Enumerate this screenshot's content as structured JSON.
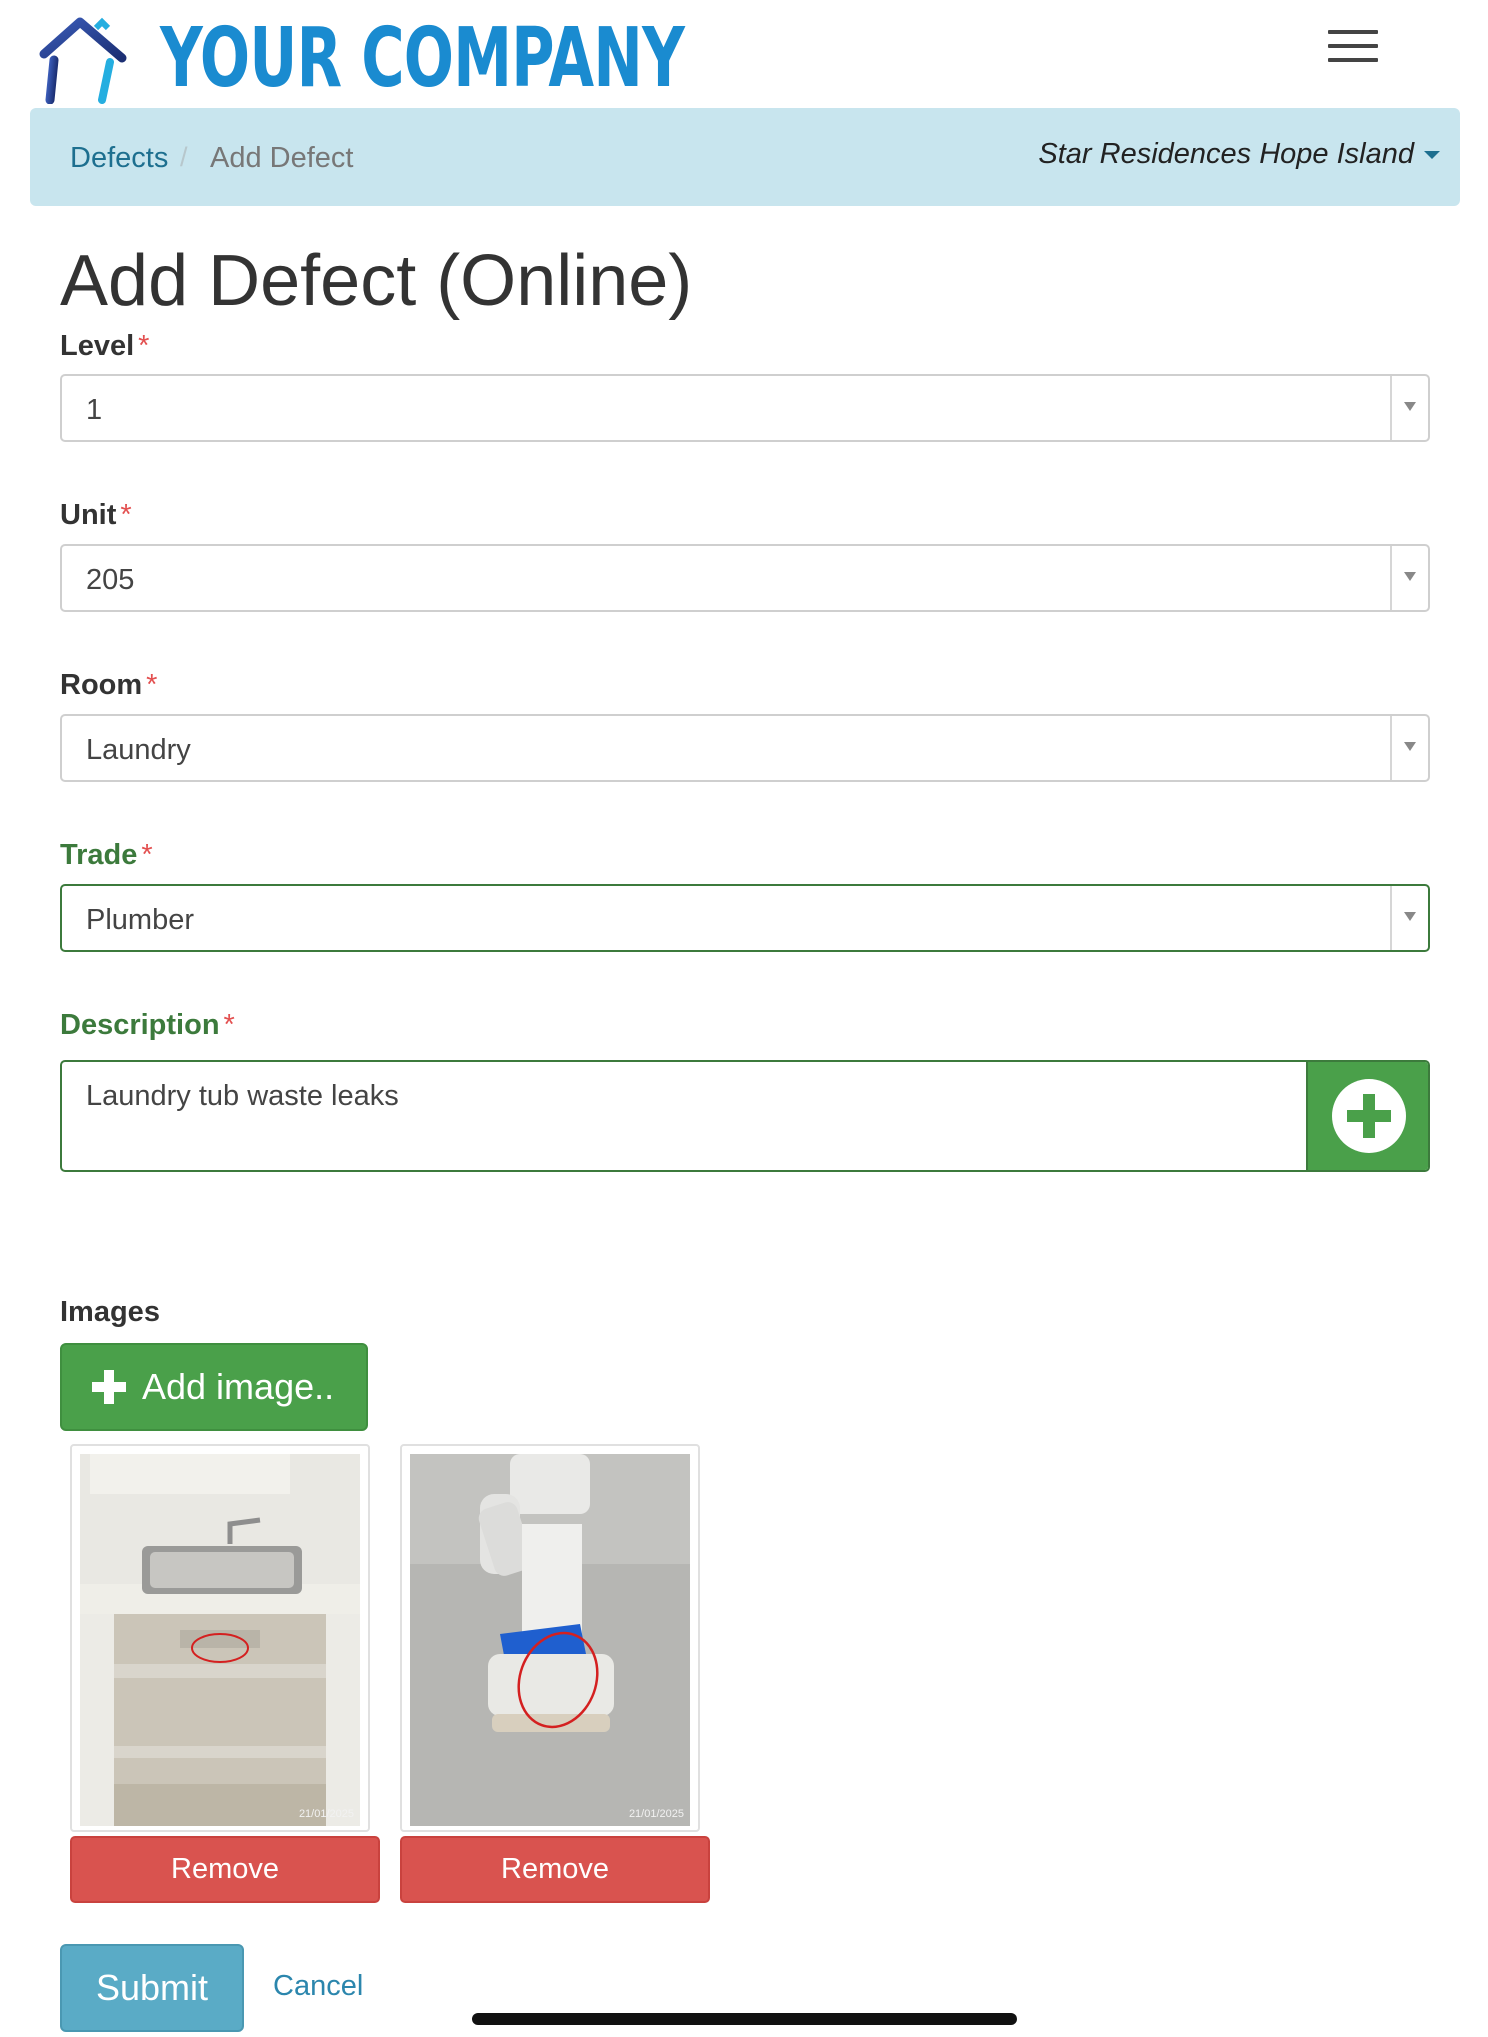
{
  "header": {
    "company_name": "YOUR COMPANY",
    "logo_icon": "house-outline-icon",
    "menu_icon": "hamburger-menu-icon"
  },
  "breadcrumb": {
    "parent": "Defects",
    "separator": "/",
    "current": "Add Defect",
    "project": "Star Residences Hope Island"
  },
  "page": {
    "title": "Add Defect (Online)"
  },
  "form": {
    "required_marker": "*",
    "level": {
      "label": "Level",
      "value": "1"
    },
    "unit": {
      "label": "Unit",
      "value": "205"
    },
    "room": {
      "label": "Room",
      "value": "Laundry"
    },
    "trade": {
      "label": "Trade",
      "value": "Plumber"
    },
    "description": {
      "label": "Description",
      "value": "Laundry tub waste leaks"
    }
  },
  "images": {
    "label": "Images",
    "add_label": "Add image..",
    "items": [
      {
        "date": "21/01/2025",
        "remove_label": "Remove"
      },
      {
        "date": "21/01/2025",
        "remove_label": "Remove"
      }
    ]
  },
  "actions": {
    "submit_label": "Submit",
    "cancel_label": "Cancel"
  },
  "colors": {
    "brand": "#1a8bd0",
    "breadcrumb_bg": "#c8e5ee",
    "success": "#4aa04a",
    "danger": "#d9534f",
    "primary": "#5aabc6",
    "valid_label": "#3c7a3c"
  }
}
